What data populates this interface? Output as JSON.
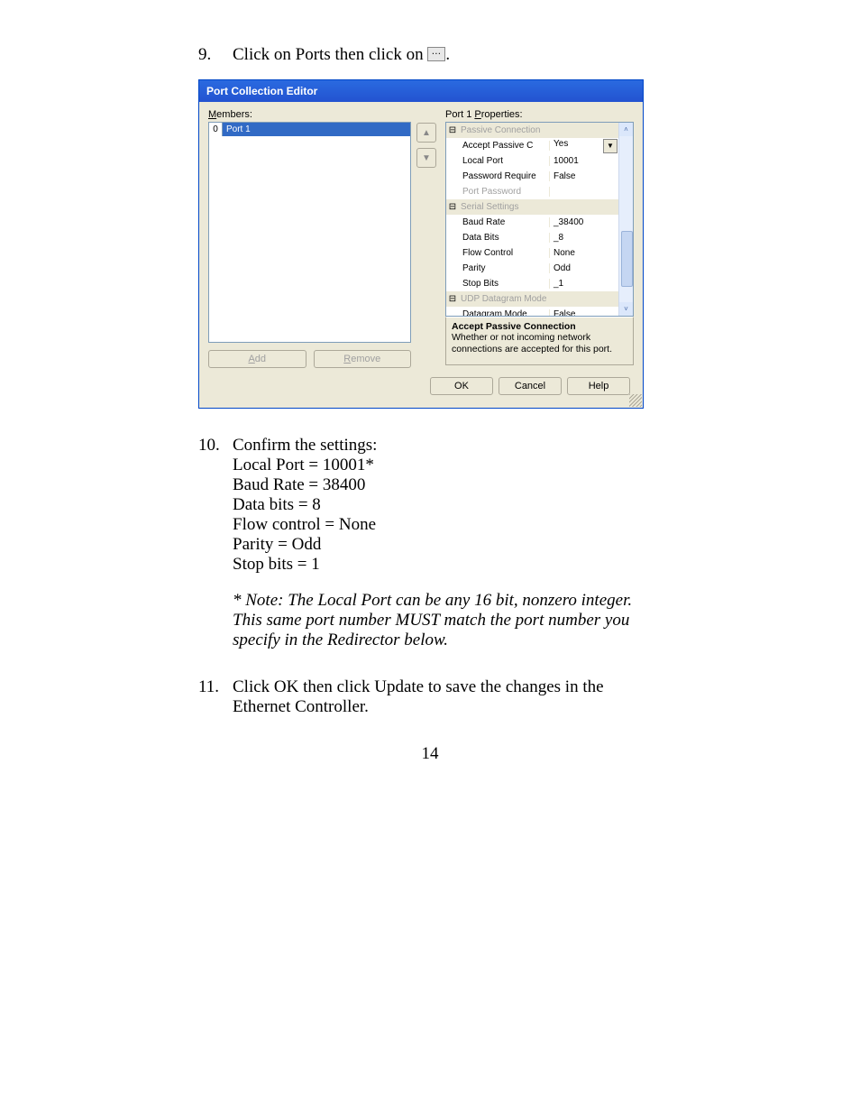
{
  "step9": {
    "num": "9.",
    "text_a": "Click on Ports then click on ",
    "text_b": "."
  },
  "dlg": {
    "title": "Port Collection Editor",
    "members_label": "Members:",
    "member_idx": "0",
    "member_name": "Port 1",
    "add_label": "Add",
    "remove_label": "Remove",
    "props_label": "Port 1 Properties:",
    "cats": {
      "passive": "Passive Connection",
      "serial": "Serial Settings",
      "udp": "UDP Datagram Mode"
    },
    "rows": {
      "accept": {
        "name": "Accept Passive C",
        "val": "Yes"
      },
      "local": {
        "name": "Local Port",
        "val": "10001"
      },
      "pwreq": {
        "name": "Password Require",
        "val": "False"
      },
      "portpw": {
        "name": "Port Password",
        "val": ""
      },
      "baud": {
        "name": "Baud Rate",
        "val": "_38400"
      },
      "datab": {
        "name": "Data Bits",
        "val": "_8"
      },
      "flow": {
        "name": "Flow Control",
        "val": "None"
      },
      "parity": {
        "name": "Parity",
        "val": "Odd"
      },
      "stop": {
        "name": "Stop Bits",
        "val": "_1"
      },
      "dgram": {
        "name": "Datagram Mode",
        "val": "False"
      }
    },
    "desc_title": "Accept Passive Connection",
    "desc_text": "Whether or not incoming network connections are accepted for this port.",
    "ok": "OK",
    "cancel": "Cancel",
    "help": "Help"
  },
  "step10": {
    "num": "10.",
    "head": "Confirm the settings:",
    "l1": "Local Port = 10001*",
    "l2": "Baud Rate = 38400",
    "l3": "Data bits = 8",
    "l4": "Flow control = None",
    "l5": "Parity = Odd",
    "l6": "Stop bits = 1"
  },
  "note": "* Note: The Local Port can be any 16 bit, nonzero integer. This same port number MUST match the port number you specify in the Redirector below.",
  "step11": {
    "num": "11.",
    "text": "Click OK then click Update to save the changes in the Ethernet Controller."
  },
  "pagenum": "14"
}
